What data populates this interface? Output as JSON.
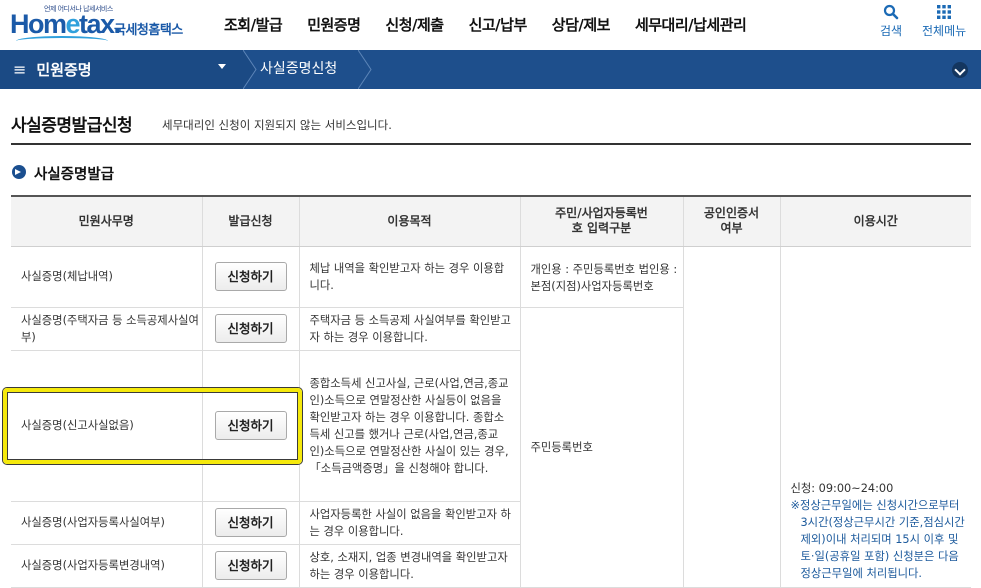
{
  "header": {
    "logo_tagline": "언제 어디서나 납세서비스",
    "logo_brand_a": "Hom",
    "logo_brand_e": "e",
    "logo_brand_b": "tax.",
    "logo_korname": "국세청홈택스",
    "menu": [
      "조회/발급",
      "민원증명",
      "신청/제출",
      "신고/납부",
      "상담/제보",
      "세무대리/납세관리"
    ],
    "search_label": "검색",
    "allmenu_label": "전체메뉴"
  },
  "breadcrumb": {
    "level1": "민원증명",
    "level2": "사실증명신청"
  },
  "page": {
    "title": "사실증명발급신청",
    "subtitle": "세무대리인 신청이 지원되지 않는 서비스입니다.",
    "section": "사실증명발급"
  },
  "table": {
    "columns": [
      "민원사무명",
      "발급신청",
      "이용목적",
      "주민/사업자등록번호 입력구분",
      "공인인증서 여부",
      "이용시간"
    ],
    "button_label": "신청하기",
    "rows": [
      {
        "name": "사실증명(체납내역)",
        "purpose": "체납 내역을 확인받고자 하는 경우 이용합니다."
      },
      {
        "name": "사실증명(주택자금 등 소득공제사실여부)",
        "purpose": "주택자금 등 소득공제 사실여부를 확인받고자 하는 경우 이용합니다."
      },
      {
        "name": "사실증명(신고사실없음)",
        "purpose": "종합소득세 신고사실, 근로(사업,연금,종교인)소득으로 연말정산한 사실등이 없음을 확인받고자 하는 경우 이용합니다. 종합소득세 신고를 했거나 근로(사업,연금,종교인)소득으로 연말정산한 사실이 있는 경우, 「소득금액증명」을 신청해야 합니다."
      },
      {
        "name": "사실증명(사업자등록사실여부)",
        "purpose": "사업자등록한 사실이 없음을 확인받고자 하는 경우 이용합니다."
      },
      {
        "name": "사실증명(사업자등록변경내역)",
        "purpose": "상호, 소재지, 업종 변경내역을 확인받고자 하는 경우 이용합니다."
      }
    ],
    "idtype_1": "개인용 : 주민등록번호 법인용 : 본점(지점)사업자등록번호",
    "idtype_2": "주민등록번호",
    "hours_1": "신청: 09:00~24:00",
    "hours_2": "※정상근무일에는 신청시간으로부터 3시간(정상근무시간 기준,점심시간 제외)이내 처리되며 15시 이후 및 토·일(공휴일 포함) 신청분은 다음 정상근무일에 처리됩니다."
  },
  "colors": {
    "brand_blue": "#1b5aa8",
    "nav_blue": "#1e4f8c",
    "link_blue": "#1c5a9c",
    "highlight": "#f5e90c"
  }
}
